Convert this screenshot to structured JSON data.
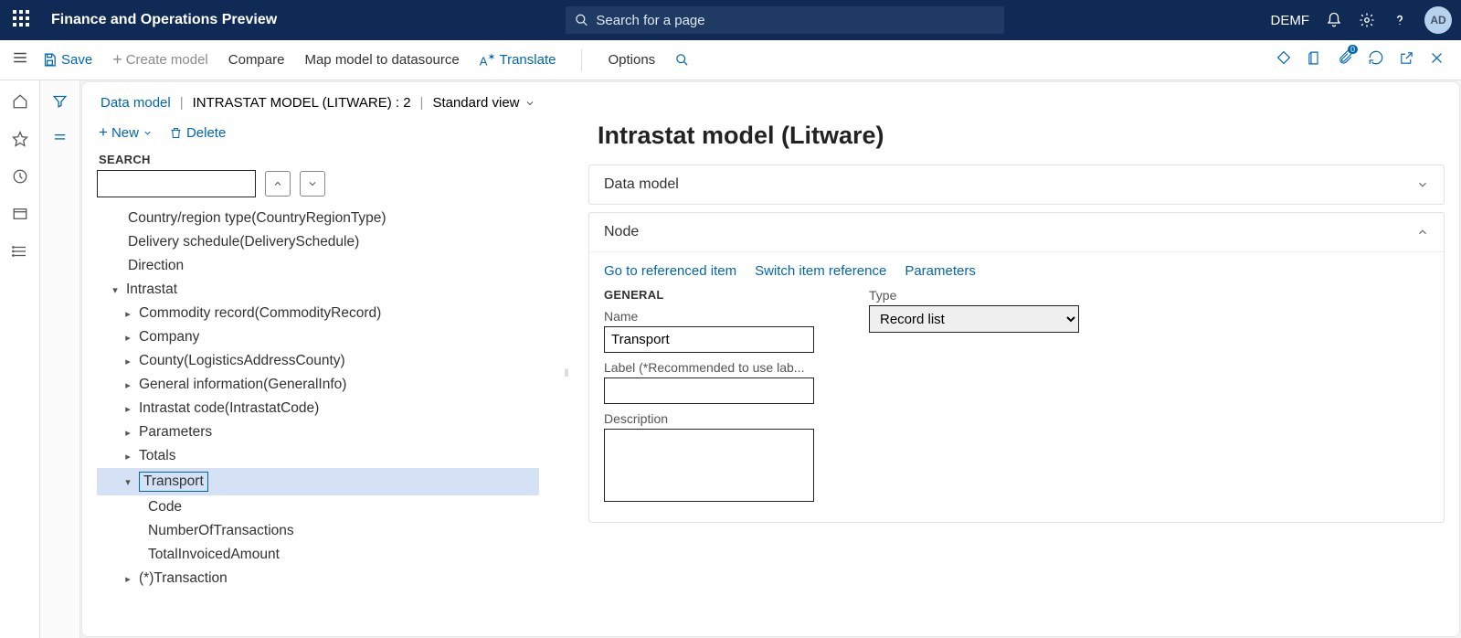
{
  "header": {
    "app_title": "Finance and Operations Preview",
    "search_placeholder": "Search for a page",
    "company_code": "DEMF",
    "avatar_initials": "AD"
  },
  "commandbar": {
    "save": "Save",
    "create_model": "Create model",
    "compare": "Compare",
    "map_model": "Map model to datasource",
    "translate": "Translate",
    "options": "Options",
    "badge_count": "0"
  },
  "breadcrumb": {
    "root": "Data model",
    "title": "INTRASTAT MODEL (LITWARE) : 2",
    "view": "Standard view"
  },
  "actions": {
    "new": "New",
    "delete": "Delete",
    "search_label": "SEARCH"
  },
  "tree": {
    "n0": "Country/region type(CountryRegionType)",
    "n1": "Delivery schedule(DeliverySchedule)",
    "n2": "Direction",
    "n3": "Intrastat",
    "n4": "Commodity record(CommodityRecord)",
    "n5": "Company",
    "n6": "County(LogisticsAddressCounty)",
    "n7": "General information(GeneralInfo)",
    "n8": "Intrastat code(IntrastatCode)",
    "n9": "Parameters",
    "n10": "Totals",
    "n11": "Transport",
    "n12": "Code",
    "n13": "NumberOfTransactions",
    "n14": "TotalInvoicedAmount",
    "n15": "(*)Transaction"
  },
  "right": {
    "page_title": "Intrastat model (Litware)",
    "section1": "Data model",
    "section2": "Node",
    "link1": "Go to referenced item",
    "link2": "Switch item reference",
    "link3": "Parameters",
    "general_label": "GENERAL",
    "name_label": "Name",
    "name_value": "Transport",
    "label_label": "Label (*Recommended to use lab...",
    "desc_label": "Description",
    "type_label": "Type",
    "type_value": "Record list"
  }
}
